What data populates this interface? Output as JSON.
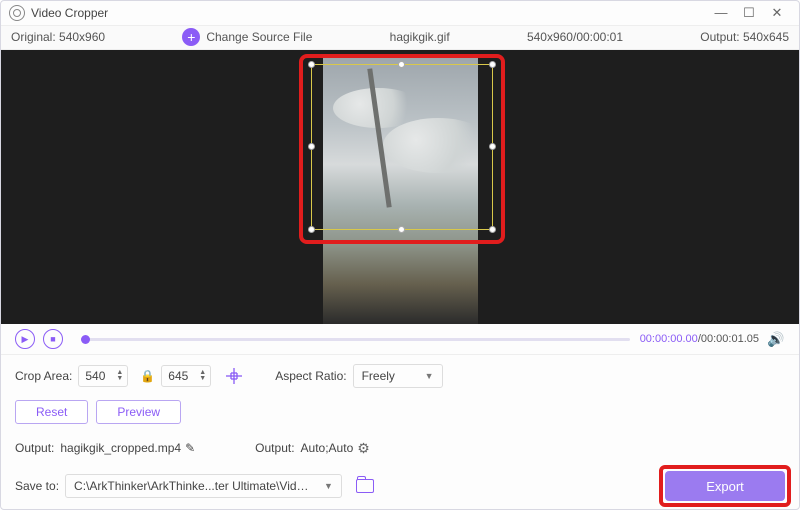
{
  "title": "Video Cropper",
  "infobar": {
    "original_label": "Original:",
    "original_size": "540x960",
    "change_source": "Change Source File",
    "filename": "hagikgik.gif",
    "src_meta": "540x960/00:00:01",
    "output_label": "Output:",
    "output_size": "540x645"
  },
  "playback": {
    "current": "00:00:00.00",
    "sep": "/",
    "total": "00:00:01.05"
  },
  "crop": {
    "area_label": "Crop Area:",
    "width": "540",
    "height": "645",
    "aspect_label": "Aspect Ratio:",
    "aspect_value": "Freely",
    "reset": "Reset",
    "preview": "Preview"
  },
  "output": {
    "file_label": "Output:",
    "file_name": "hagikgik_cropped.mp4",
    "settings_label": "Output:",
    "settings_value": "Auto;Auto"
  },
  "save": {
    "label": "Save to:",
    "path": "C:\\ArkThinker\\ArkThinke...ter Ultimate\\Video Crop"
  },
  "export_label": "Export"
}
